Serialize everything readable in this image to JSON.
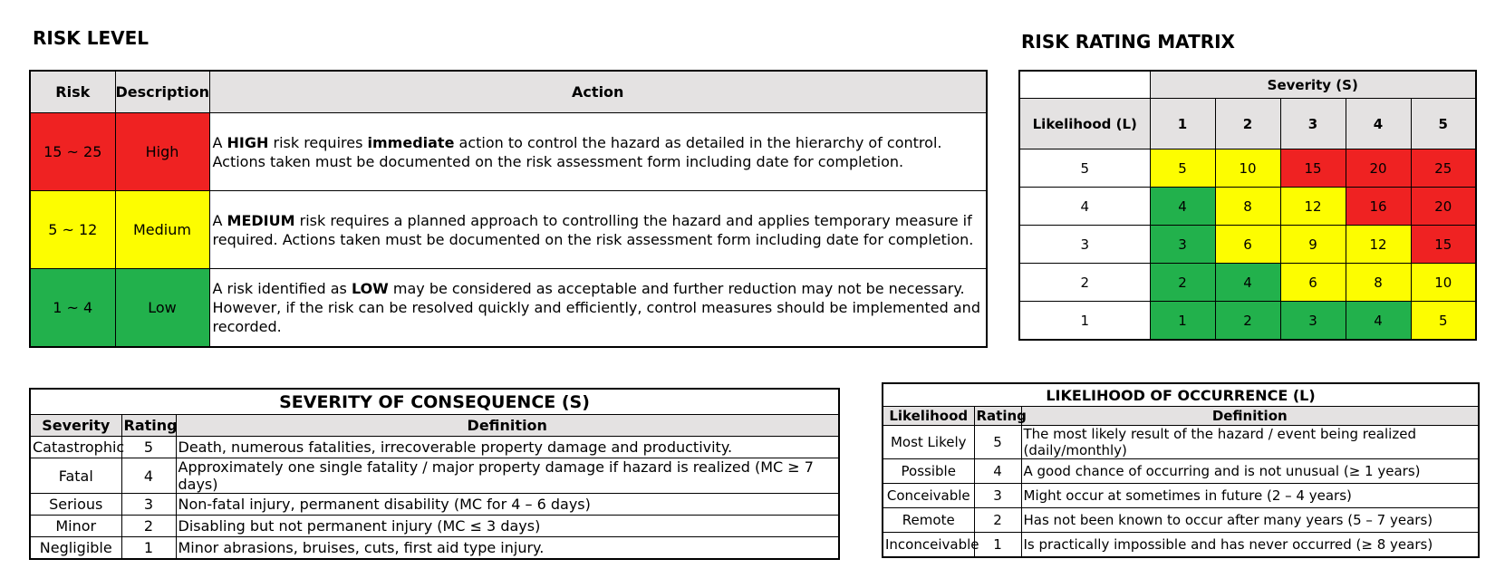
{
  "risk_level": {
    "title": "RISK LEVEL",
    "headers": {
      "risk": "Risk",
      "description": "Description",
      "action": "Action"
    },
    "rows": [
      {
        "risk": "15 ~ 25",
        "description": "High",
        "color": "#ef2222",
        "action": {
          "p1": "A ",
          "b1": "HIGH",
          "p2": " risk requires ",
          "b2": "immediate",
          "p3": " action to control the hazard as detailed in the hierarchy of control. Actions taken must be documented on the risk assessment form including date for completion."
        }
      },
      {
        "risk": "5 ~ 12",
        "description": "Medium",
        "color": "#fdfd00",
        "action": {
          "p1": "A ",
          "b1": "MEDIUM",
          "p2": " risk requires a planned approach to controlling the hazard and applies temporary measure if required. Actions taken must be documented on the risk assessment form including date for completion."
        }
      },
      {
        "risk": "1 ~ 4",
        "description": "Low",
        "color": "#22b14c",
        "action": {
          "p1": "A risk identified as ",
          "b1": "LOW",
          "p2": " may be considered as acceptable and further reduction may not be necessary. However, if the risk can be resolved quickly and efficiently, control measures should be implemented and recorded."
        }
      }
    ]
  },
  "risk_matrix": {
    "title": "RISK RATING MATRIX",
    "severity_label": "Severity (S)",
    "likelihood_label": "Likelihood (L)",
    "severity_cols": [
      "1",
      "2",
      "3",
      "4",
      "5"
    ],
    "rows": [
      {
        "likelihood": "5",
        "cells": [
          "5",
          "10",
          "15",
          "20",
          "25"
        ]
      },
      {
        "likelihood": "4",
        "cells": [
          "4",
          "8",
          "12",
          "16",
          "20"
        ]
      },
      {
        "likelihood": "3",
        "cells": [
          "3",
          "6",
          "9",
          "12",
          "15"
        ]
      },
      {
        "likelihood": "2",
        "cells": [
          "2",
          "4",
          "6",
          "8",
          "10"
        ]
      },
      {
        "likelihood": "1",
        "cells": [
          "1",
          "2",
          "3",
          "4",
          "5"
        ]
      }
    ]
  },
  "severity": {
    "title": "SEVERITY OF CONSEQUENCE (S)",
    "headers": {
      "severity": "Severity",
      "rating": "Rating",
      "definition": "Definition"
    },
    "rows": [
      {
        "severity": "Catastrophic",
        "rating": "5",
        "definition": "Death, numerous fatalities, irrecoverable property damage and productivity."
      },
      {
        "severity": "Fatal",
        "rating": "4",
        "definition": "Approximately one single fatality / major property damage if hazard is realized (MC ≥ 7 days)"
      },
      {
        "severity": "Serious",
        "rating": "3",
        "definition": "Non-fatal injury, permanent disability (MC for 4 – 6 days)"
      },
      {
        "severity": "Minor",
        "rating": "2",
        "definition": "Disabling but not permanent injury (MC ≤ 3 days)"
      },
      {
        "severity": "Negligible",
        "rating": "1",
        "definition": "Minor abrasions, bruises, cuts, first aid type injury."
      }
    ]
  },
  "likelihood": {
    "title": "LIKELIHOOD OF OCCURRENCE (L)",
    "headers": {
      "likelihood": "Likelihood",
      "rating": "Rating",
      "definition": "Definition"
    },
    "rows": [
      {
        "likelihood": "Most Likely",
        "rating": "5",
        "definition": "The most likely result of the hazard / event being realized (daily/monthly)"
      },
      {
        "likelihood": "Possible",
        "rating": "4",
        "definition": "A good chance of occurring and is not unusual (≥ 1 years)"
      },
      {
        "likelihood": "Conceivable",
        "rating": "3",
        "definition": "Might occur at sometimes in future (2 – 4 years)"
      },
      {
        "likelihood": "Remote",
        "rating": "2",
        "definition": "Has not been known to occur after many years (5 – 7 years)"
      },
      {
        "likelihood": "Inconceivable",
        "rating": "1",
        "definition": "Is practically impossible and has never occurred (≥ 8 years)"
      }
    ]
  },
  "colors": {
    "high": "#ef2222",
    "medium": "#fdfd00",
    "low": "#22b14c",
    "header_bg": "#e4e2e2"
  }
}
